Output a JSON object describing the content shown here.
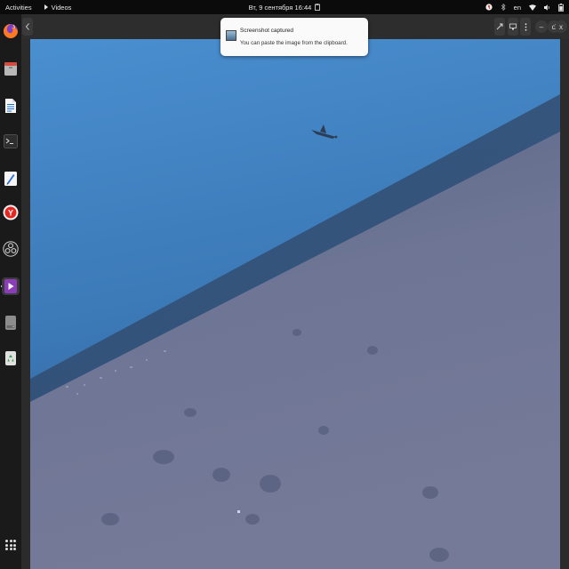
{
  "topbar": {
    "activities": "Activities",
    "app_menu": "Videos",
    "clock": "Вт, 9 сентября  16:44",
    "language": "en"
  },
  "window": {
    "back_icon": "chevron-left-icon",
    "controls": [
      "rotate-icon",
      "screenshot-icon",
      "menu-icon",
      "minimize-icon",
      "restore-icon",
      "close-icon"
    ],
    "minimize_label": "–",
    "restore_label": "d",
    "close_label": "x"
  },
  "notification": {
    "title": "Screenshot captured",
    "body": "You can paste the image from the clipboard."
  },
  "dock": {
    "items": [
      "firefox",
      "files",
      "libreoffice-writer",
      "terminal",
      "text-editor",
      "yandex-browser",
      "obs-studio",
      "videos",
      "disks",
      "trash"
    ],
    "yandex_letter": "Y"
  },
  "colors": {
    "topbar": "#0b0b0b",
    "dock": "#1a1a1a",
    "sky": "#3f7fbf",
    "ground": "#6d7595"
  }
}
